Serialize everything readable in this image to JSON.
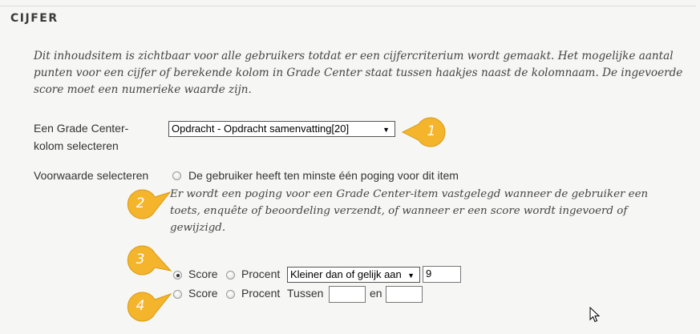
{
  "section": {
    "title": "CIJFER"
  },
  "intro": "Dit inhoudsitem is zichtbaar voor alle gebruikers totdat er een cijfercriterium wordt gemaakt. Het mogelijke aantal punten voor een cijfer of berekende kolom in Grade Center staat tussen haakjes naast de kolomnaam. De ingevoerde score moet een numerieke waarde zijn.",
  "column": {
    "label_line1": "Een Grade Center-",
    "label_line2": "kolom selecteren",
    "selected": "Opdracht - Opdracht samenvatting[20]"
  },
  "condition": {
    "label": "Voorwaarde selecteren",
    "attempt_option": "De gebruiker heeft ten minste één poging voor dit item",
    "attempt_note": "Er wordt een poging voor een Grade Center-item vastgelegd wanneer de gebruiker een toets, enquête of beoordeling verzendt, of wanneer er een score wordt ingevoerd of gewijzigd.",
    "row1": {
      "score_label": "Score",
      "percent_label": "Procent",
      "operator": "Kleiner dan of gelijk aan",
      "value": "9"
    },
    "row2": {
      "score_label": "Score",
      "percent_label": "Procent",
      "between_label": "Tussen",
      "and_label": "en",
      "from_value": "",
      "to_value": ""
    }
  },
  "callouts": [
    "1",
    "2",
    "3",
    "4"
  ],
  "colors": {
    "callout": "#f4b52c",
    "background": "#f6f6f4"
  }
}
